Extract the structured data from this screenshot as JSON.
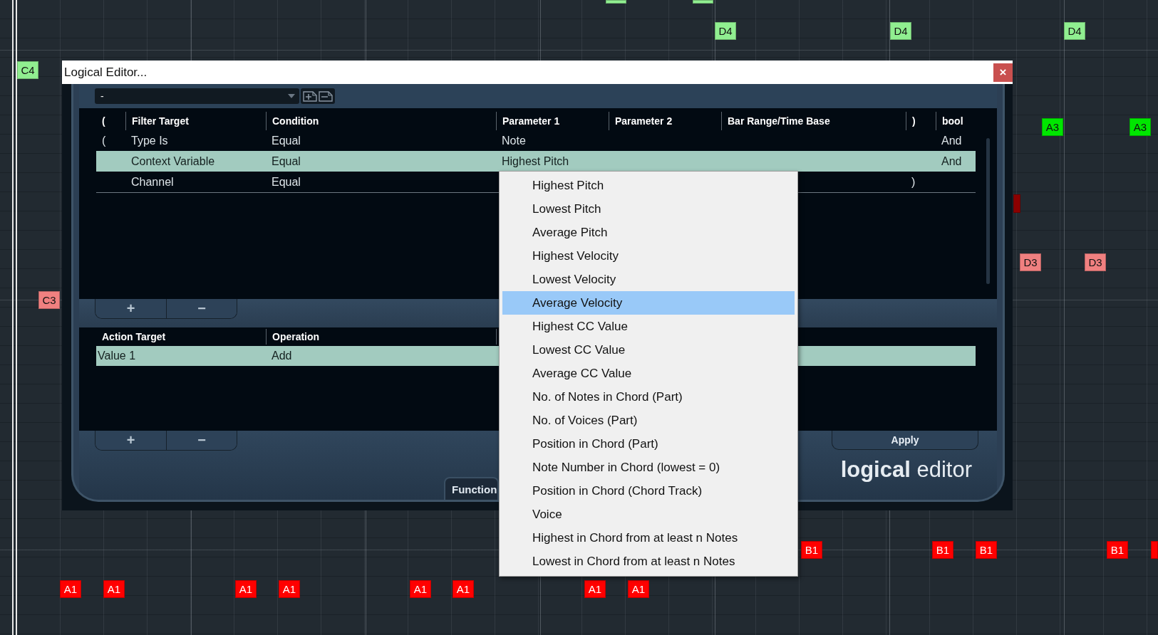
{
  "piano_roll": {
    "notes": [
      {
        "color": "#90ee90"
      },
      {
        "color": "#90ee90"
      },
      {
        "label": "D4",
        "color": "#90ee90"
      },
      {
        "label": "D4",
        "color": "#90ee90"
      },
      {
        "label": "D4",
        "color": "#90ee90"
      },
      {
        "label": "C4",
        "color": "#90ee90"
      },
      {
        "label": "A3",
        "color": "#00e600"
      },
      {
        "label": "A3",
        "color": "#00e600"
      },
      {
        "color": "#8b0000"
      },
      {
        "label": "D3",
        "color": "#f08080"
      },
      {
        "label": "D3",
        "color": "#f08080"
      },
      {
        "label": "C3",
        "color": "#f08080"
      },
      {
        "label": "B1",
        "color": "#ff0000"
      },
      {
        "label": "B1",
        "color": "#ff0000"
      },
      {
        "label": "B1",
        "color": "#ff0000"
      },
      {
        "label": "B1",
        "color": "#ff0000"
      },
      {
        "color": "#ff0000"
      },
      {
        "label": "A1",
        "color": "#ff0000"
      },
      {
        "label": "A1",
        "color": "#ff0000"
      },
      {
        "label": "A1",
        "color": "#ff0000"
      },
      {
        "label": "A1",
        "color": "#ff0000"
      },
      {
        "label": "A1",
        "color": "#ff0000"
      },
      {
        "label": "A1",
        "color": "#ff0000"
      },
      {
        "label": "A1",
        "color": "#ff0000"
      },
      {
        "label": "A1",
        "color": "#ff0000"
      }
    ]
  },
  "dialog": {
    "title": "Logical Editor...",
    "close": "×",
    "preset": {
      "value": "-"
    },
    "filter_table": {
      "columns": [
        "(",
        "Filter Target",
        "Condition",
        "Parameter 1",
        "Parameter 2",
        "Bar Range/Time Base",
        ")",
        "bool"
      ],
      "rows": [
        {
          "open_paren": "(",
          "filter_target": "Type Is",
          "condition": "Equal",
          "parameter_1": "Note",
          "bool": "And",
          "selected": false
        },
        {
          "filter_target": "Context Variable",
          "condition": "Equal",
          "parameter_1": "Highest Pitch",
          "bool": "And",
          "selected": true
        },
        {
          "filter_target": "Channel",
          "condition": "Equal",
          "close_paren": ")",
          "selected": false
        }
      ]
    },
    "filter_buttons": {
      "add": "+",
      "remove": "−"
    },
    "action_table": {
      "columns": [
        "Action Target",
        "Operation"
      ],
      "rows": [
        {
          "action_target": "Value 1",
          "operation": "Add",
          "selected": true
        }
      ]
    },
    "action_buttons": {
      "add": "+",
      "remove": "−"
    },
    "apply": "Apply",
    "function_tab": "Function",
    "logo": "**logical** editor"
  },
  "menu": {
    "items": [
      {
        "label": "Highest Pitch",
        "selected": false
      },
      {
        "label": "Lowest Pitch",
        "selected": false
      },
      {
        "label": "Average Pitch",
        "selected": false
      },
      {
        "label": "Highest Velocity",
        "selected": false
      },
      {
        "label": "Lowest Velocity",
        "selected": false
      },
      {
        "label": "Average Velocity",
        "selected": true
      },
      {
        "label": "Highest CC Value",
        "selected": false
      },
      {
        "label": "Lowest CC Value",
        "selected": false
      },
      {
        "label": "Average CC Value",
        "selected": false
      },
      {
        "label": "No. of Notes in Chord (Part)",
        "selected": false
      },
      {
        "label": "No. of Voices (Part)",
        "selected": false
      },
      {
        "label": "Position in Chord (Part)",
        "selected": false
      },
      {
        "label": "Note Number in Chord (lowest = 0)",
        "selected": false
      },
      {
        "label": "Position in Chord (Chord Track)",
        "selected": false
      },
      {
        "label": "Voice",
        "selected": false
      },
      {
        "label": "Highest in Chord from at least n Notes",
        "selected": false
      },
      {
        "label": "Lowest in Chord from at least n Notes",
        "selected": false
      }
    ]
  }
}
